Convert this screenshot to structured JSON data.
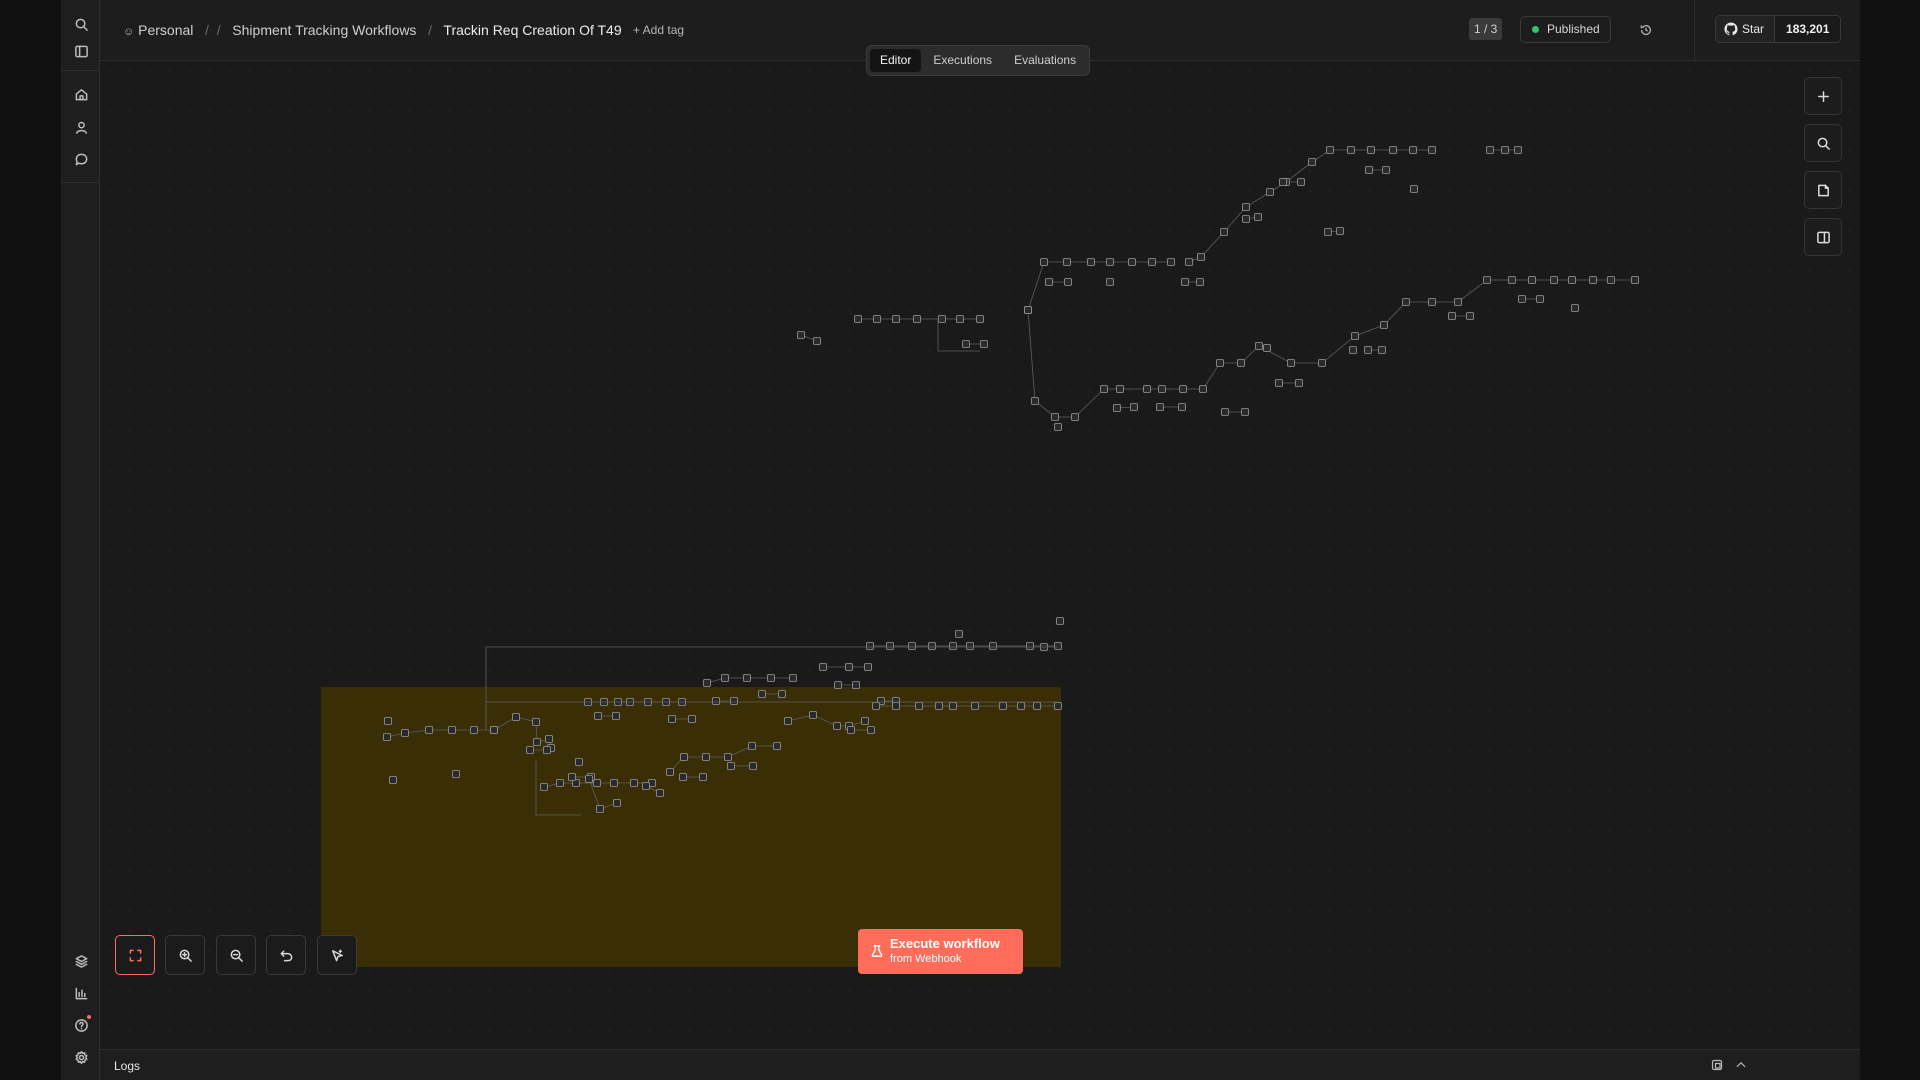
{
  "breadcrumb": {
    "project": "Personal",
    "folder": "Shipment Tracking Workflows",
    "workflow": "Trackin Req Creation Of T49"
  },
  "add_tag": "+ Add tag",
  "version_counter": "1 / 3",
  "status": {
    "label": "Published",
    "color": "#32c36c"
  },
  "github": {
    "star_label": "Star",
    "count": "183,201"
  },
  "tabs": [
    {
      "label": "Editor",
      "active": true
    },
    {
      "label": "Executions",
      "active": false
    },
    {
      "label": "Evaluations",
      "active": false
    }
  ],
  "execute": {
    "main": "Execute workflow",
    "sub": "from Webhook"
  },
  "logs": {
    "title": "Logs"
  },
  "colors": {
    "accent": "#ff6d5a",
    "sticky": "#3a2e06",
    "status_dot": "#32c36c"
  },
  "sidebar_icons": [
    "search-icon",
    "panel-toggle-icon",
    "home-icon",
    "user-icon",
    "chat-icon",
    "templates-icon",
    "insights-icon",
    "help-icon",
    "settings-icon"
  ],
  "canvas_controls": [
    "add-node-icon",
    "search-icon",
    "sticky-note-icon",
    "panel-toggle-icon"
  ],
  "zoom_controls": [
    "fit-view-icon",
    "zoom-in-icon",
    "zoom-out-icon",
    "undo-icon",
    "tidy-up-icon"
  ]
}
